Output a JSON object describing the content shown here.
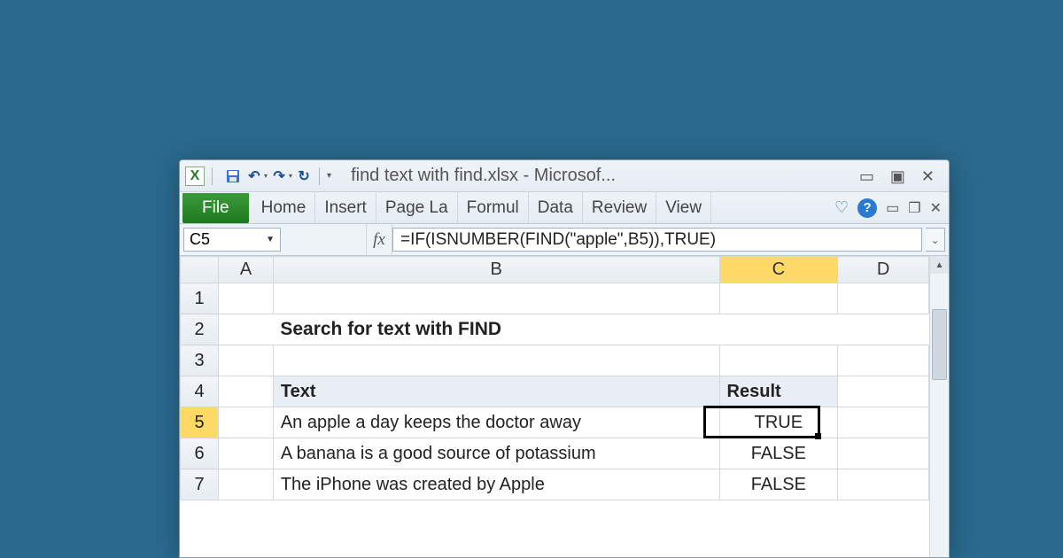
{
  "titlebar": {
    "title": "find text with find.xlsx  -  Microsof..."
  },
  "ribbon": {
    "file": "File",
    "tabs": [
      "Home",
      "Insert",
      "Page La",
      "Formul",
      "Data",
      "Review",
      "View"
    ]
  },
  "formula_bar": {
    "name_box": "C5",
    "fx_label": "fx",
    "formula": "=IF(ISNUMBER(FIND(\"apple\",B5)),TRUE)"
  },
  "columns": [
    "A",
    "B",
    "C",
    "D"
  ],
  "rows": [
    {
      "num": "1",
      "A": "",
      "B": "",
      "C": "",
      "D": ""
    },
    {
      "num": "2",
      "A": "",
      "B": "Search for text with FIND",
      "C": "",
      "D": "",
      "title": true
    },
    {
      "num": "3",
      "A": "",
      "B": "",
      "C": "",
      "D": ""
    },
    {
      "num": "4",
      "A": "",
      "B": "Text",
      "C": "Result",
      "D": "",
      "header": true
    },
    {
      "num": "5",
      "A": "",
      "B": "An apple a day keeps the doctor away",
      "C": "TRUE",
      "D": ""
    },
    {
      "num": "6",
      "A": "",
      "B": "A banana is a good source of potassium",
      "C": "FALSE",
      "D": ""
    },
    {
      "num": "7",
      "A": "",
      "B": "The iPhone was created by Apple",
      "C": "FALSE",
      "D": ""
    }
  ],
  "selection": {
    "cell": "C5",
    "row": "5",
    "col": "C"
  }
}
